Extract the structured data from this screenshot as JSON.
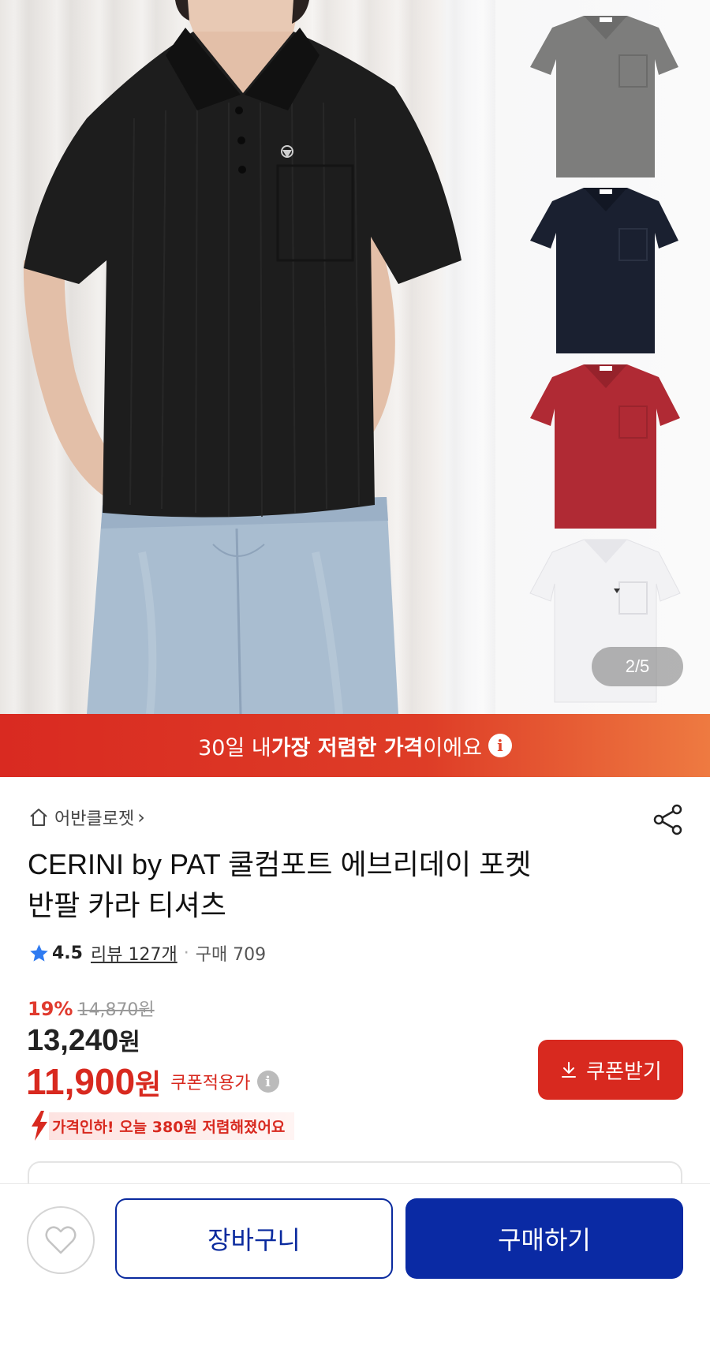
{
  "gallery": {
    "page_indicator": "2/5",
    "thumbnail_colors": [
      "#7d7d7c",
      "#1a2030",
      "#b02a34",
      "#f2f2f4"
    ]
  },
  "promo": {
    "prefix": "30일 내 ",
    "highlight": "가장 저렴한 가격",
    "suffix": "이에요"
  },
  "store": {
    "name": "어반클로젯",
    "chevron": "›"
  },
  "product": {
    "title_line1": "CERINI by PAT 쿨컴포트 에브리데이 포켓",
    "title_line2": "반팔 카라 티셔츠"
  },
  "rating": {
    "score": "4.5",
    "reviews": "리뷰 127개",
    "separator": "·",
    "sales": "구매 709"
  },
  "price": {
    "discount_pct": "19%",
    "original": "14,870원",
    "sale_number": "13,240",
    "sale_unit": "원",
    "coupon_number": "11,900",
    "coupon_unit": "원",
    "coupon_label": "쿠폰적용가",
    "coupon_button": "쿠폰받기",
    "drop_notice": "가격인하! 오늘 380원 저렴해졌어요"
  },
  "bottom": {
    "cart_label": "장바구니",
    "buy_label": "구매하기"
  },
  "colors": {
    "accent_red": "#d8291f",
    "brand_blue": "#0a2aa4"
  }
}
